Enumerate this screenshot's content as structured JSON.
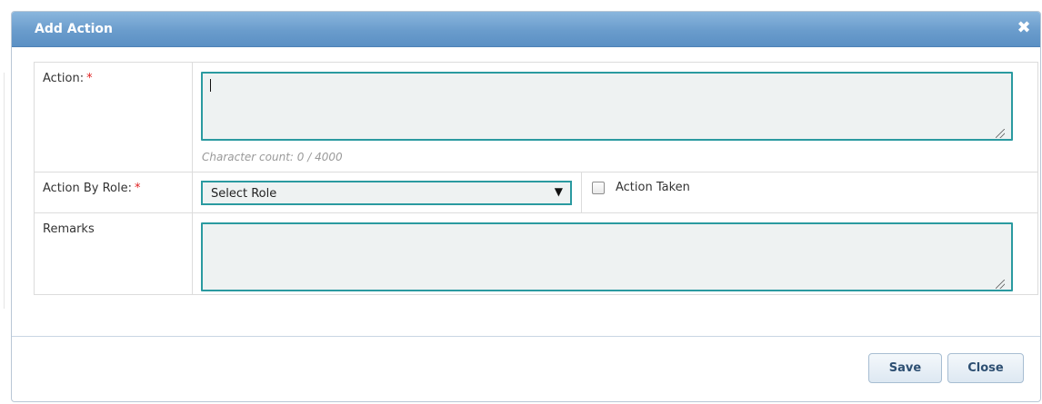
{
  "dialog": {
    "title": "Add Action",
    "close_glyph": "✖"
  },
  "form": {
    "action": {
      "label": "Action:",
      "required_mark": "*",
      "value": "",
      "char_count": "Character count: 0 / 4000"
    },
    "role": {
      "label": "Action By Role:",
      "required_mark": "*",
      "selected": "Select Role",
      "arrow_glyph": "▼"
    },
    "action_taken": {
      "label": "Action Taken",
      "checked": false
    },
    "remarks": {
      "label": "Remarks",
      "value": ""
    }
  },
  "buttons": {
    "save": "Save",
    "close": "Close"
  },
  "colors": {
    "titlebar": "#6a9ccc",
    "field_border": "#2a9aa0",
    "field_bg": "#eef2f2",
    "required": "#e02020",
    "button_text": "#2d4f72"
  },
  "icons": {
    "close": "close-icon",
    "dropdown": "chevron-down-icon",
    "resize": "resize-grip-icon"
  }
}
